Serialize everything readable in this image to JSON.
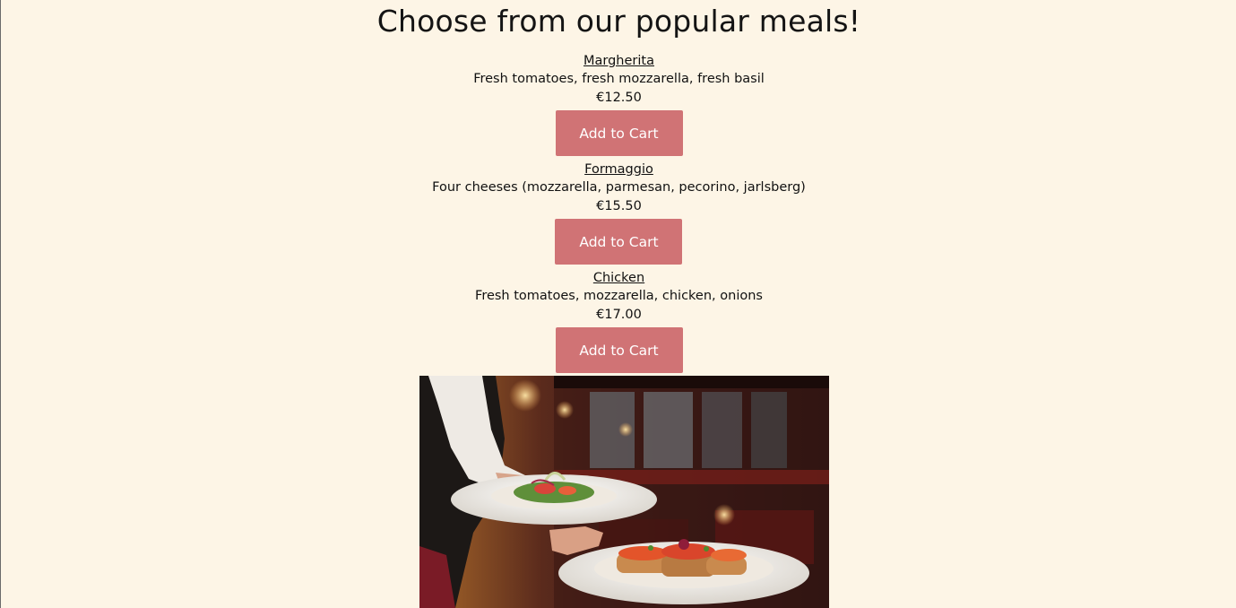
{
  "page": {
    "title": "Choose from our popular meals!"
  },
  "meals": [
    {
      "name": "Margherita",
      "description": "Fresh tomatoes, fresh mozzarella, fresh basil",
      "price": "€12.50",
      "button_label": "Add to Cart"
    },
    {
      "name": "Formaggio",
      "description": "Four cheeses (mozzarella, parmesan, pecorino, jarlsberg)",
      "price": "€15.50",
      "button_label": "Add to Cart"
    },
    {
      "name": "Chicken",
      "description": "Fresh tomatoes, mozzarella, chicken, onions",
      "price": "€17.00",
      "button_label": "Add to Cart"
    }
  ],
  "colors": {
    "background": "#fdf5e6",
    "button": "#d07375",
    "button_text": "#ffffff"
  },
  "hero_image": {
    "icon": "waiter-with-plates-photo"
  }
}
